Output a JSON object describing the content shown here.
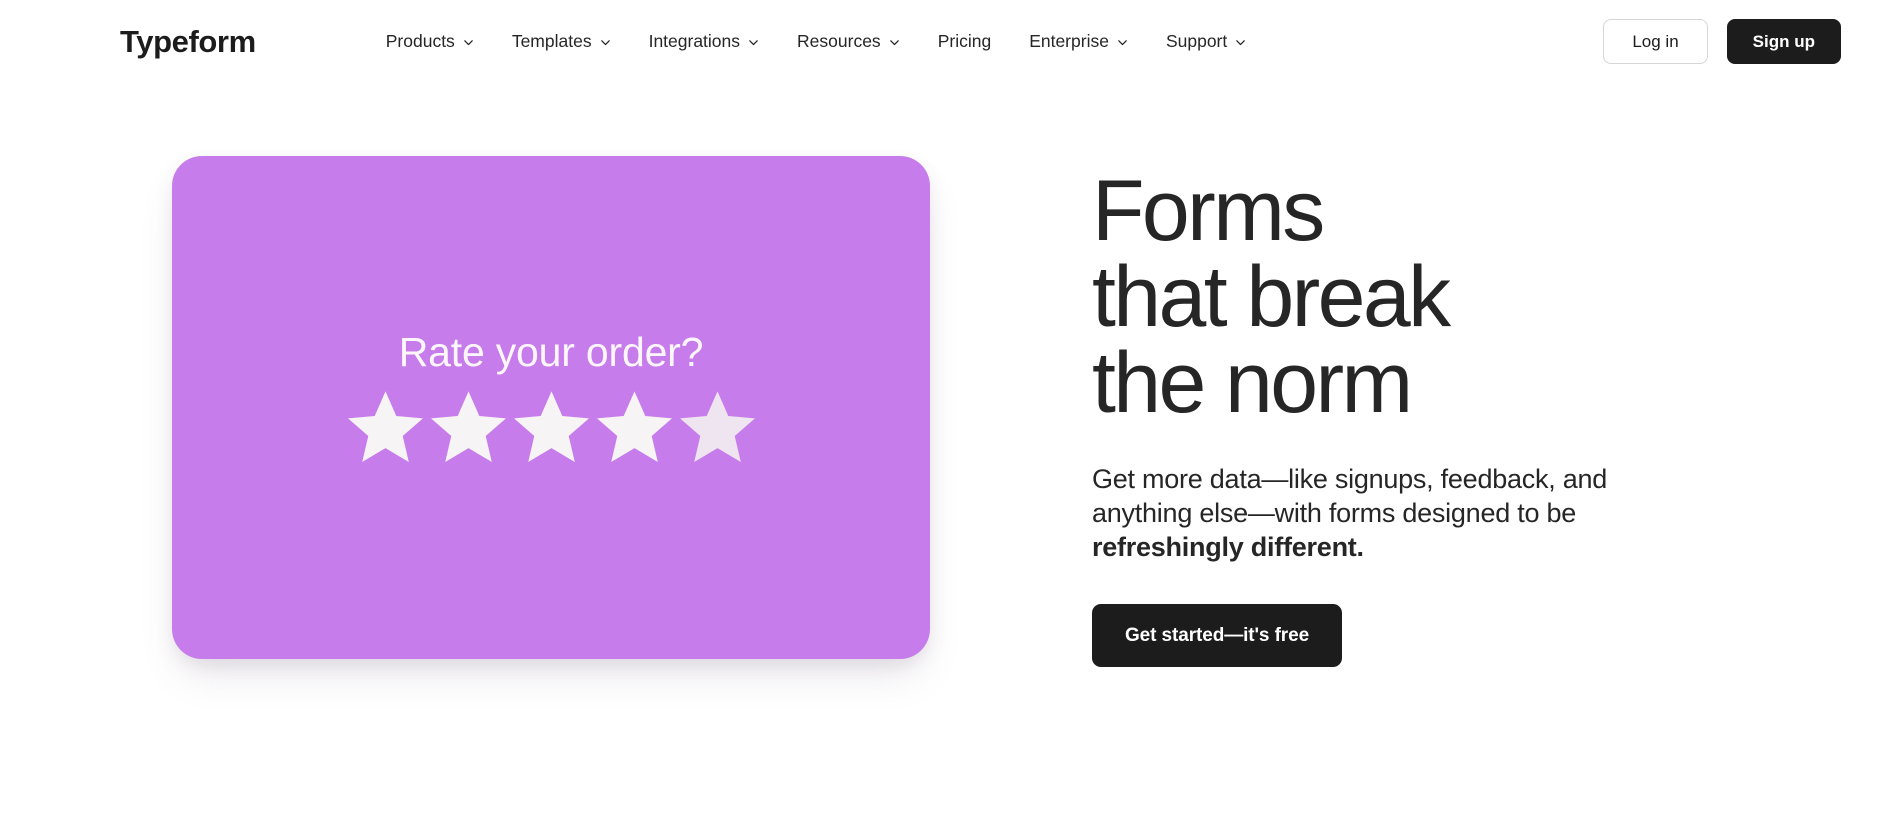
{
  "header": {
    "brand": "Typeform",
    "nav": [
      {
        "label": "Products",
        "has_caret": true,
        "icon": "chevron-down-icon"
      },
      {
        "label": "Templates",
        "has_caret": true,
        "icon": "chevron-down-icon"
      },
      {
        "label": "Integrations",
        "has_caret": true,
        "icon": "chevron-down-icon"
      },
      {
        "label": "Resources",
        "has_caret": true,
        "icon": "chevron-down-icon"
      },
      {
        "label": "Pricing",
        "has_caret": false,
        "icon": ""
      },
      {
        "label": "Enterprise",
        "has_caret": true,
        "icon": "chevron-down-icon"
      },
      {
        "label": "Support",
        "has_caret": true,
        "icon": "chevron-down-icon"
      }
    ],
    "login_label": "Log in",
    "signup_label": "Sign up"
  },
  "hero": {
    "card": {
      "question": "Rate your order?",
      "star_count": 5,
      "star_icon": "star-icon",
      "background_color": "#c77ceb",
      "text_color": "#fdf7fd",
      "star_color": "#f7f4f5"
    },
    "headline_lines": [
      "Forms",
      "that break",
      "the norm"
    ],
    "subcopy": {
      "part1": "Get more data—like signups, feedback, and anything else—with forms designed to be ",
      "emphasis": "refreshingly different."
    },
    "cta_label": "Get started—it's free"
  },
  "colors": {
    "ink": "#262627",
    "dark_button": "#1c1c1c",
    "page_background": "#ffffff",
    "card_purple": "#c77ceb",
    "login_border": "#d6d6d6"
  }
}
